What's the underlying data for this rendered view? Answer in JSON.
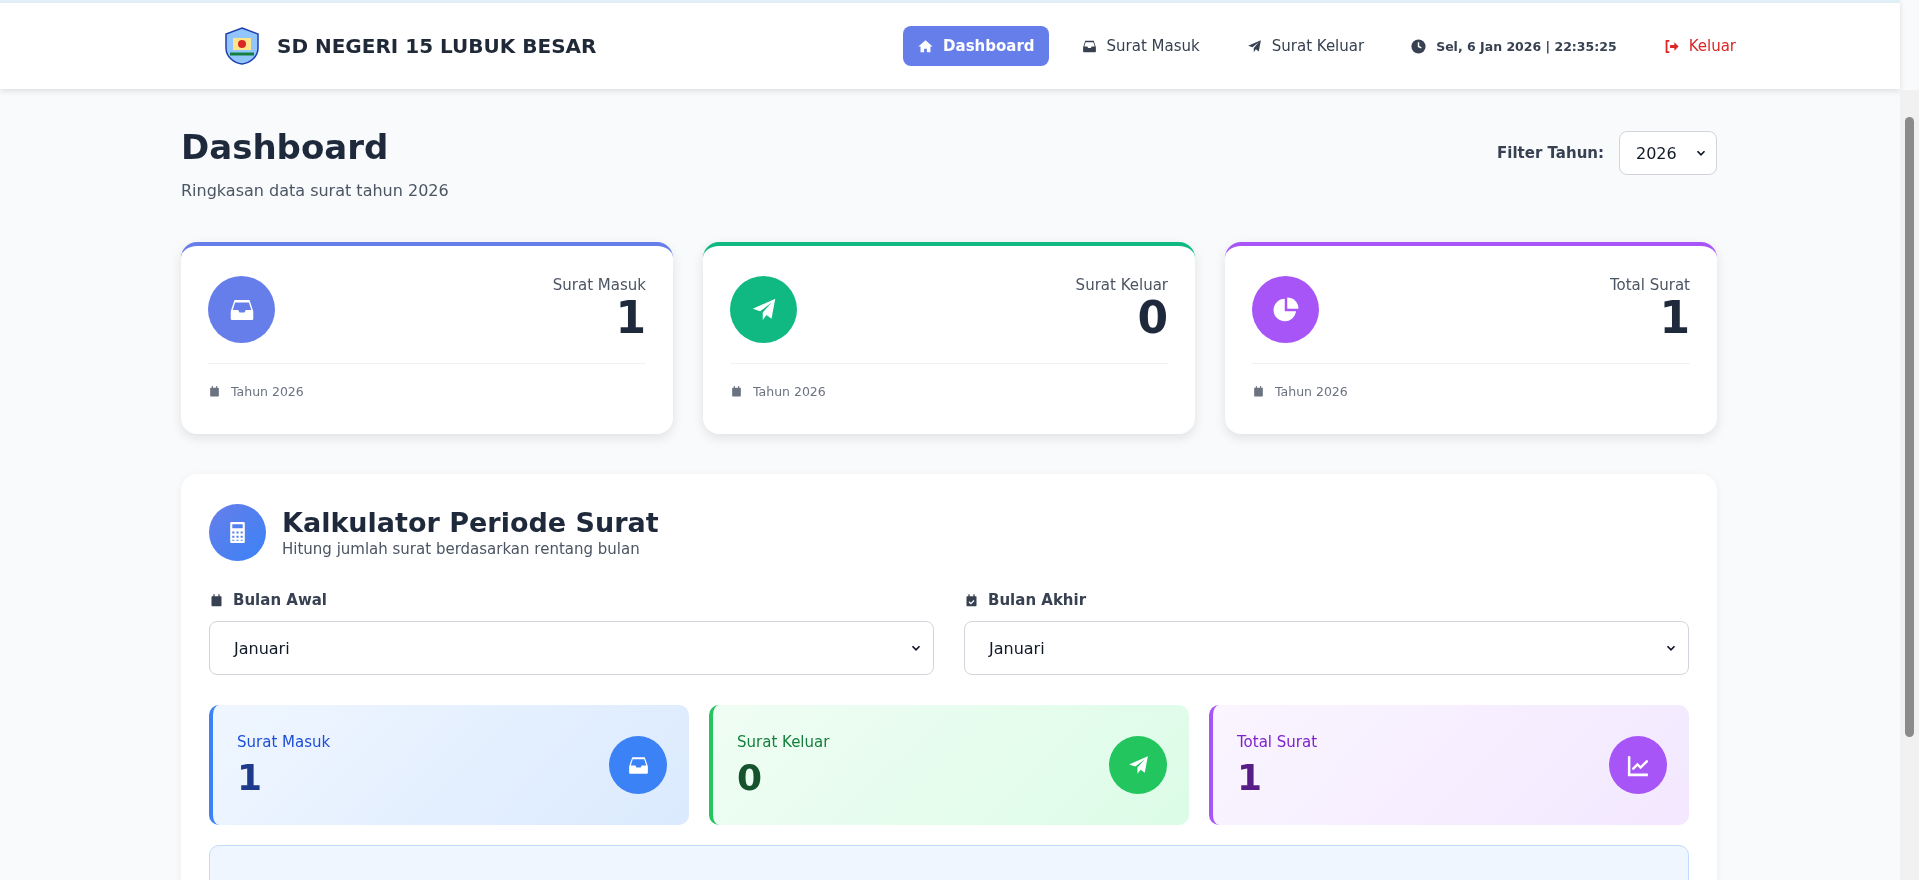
{
  "header": {
    "school_name": "SD NEGERI 15 LUBUK BESAR",
    "nav": [
      {
        "label": "Dashboard",
        "kind": "home",
        "selected": true
      },
      {
        "label": "Surat Masuk",
        "kind": "inbox",
        "selected": false
      },
      {
        "label": "Surat Keluar",
        "kind": "send",
        "selected": false
      }
    ],
    "clock": "Sel, 6 Jan 2026 | 22:35:25",
    "logout": "Keluar"
  },
  "page": {
    "title": "Dashboard",
    "subtitle": "Ringkasan data surat tahun 2026",
    "filter_label": "Filter Tahun:",
    "filter_value": "2026"
  },
  "stat_cards": [
    {
      "label": "Surat Masuk",
      "value": "1",
      "footer": "Tahun 2026",
      "kind": "inbox",
      "color": "#667eea"
    },
    {
      "label": "Surat Keluar",
      "value": "0",
      "footer": "Tahun 2026",
      "kind": "send",
      "color": "#10b981"
    },
    {
      "label": "Total Surat",
      "value": "1",
      "footer": "Tahun 2026",
      "kind": "pie",
      "color": "#a855f7"
    }
  ],
  "calculator": {
    "title": "Kalkulator Periode Surat",
    "subtitle": "Hitung jumlah surat berdasarkan rentang bulan",
    "fields": [
      {
        "label": "Bulan Awal",
        "value": "Januari",
        "kind": "calendar"
      },
      {
        "label": "Bulan Akhir",
        "value": "Januari",
        "kind": "calendar-check"
      }
    ],
    "results": [
      {
        "label": "Surat Masuk",
        "value": "1",
        "kind": "inbox",
        "color": "#3b82f6"
      },
      {
        "label": "Surat Keluar",
        "value": "0",
        "kind": "send",
        "color": "#22c55e"
      },
      {
        "label": "Total Surat",
        "value": "1",
        "kind": "line",
        "color": "#a855f7"
      }
    ]
  }
}
